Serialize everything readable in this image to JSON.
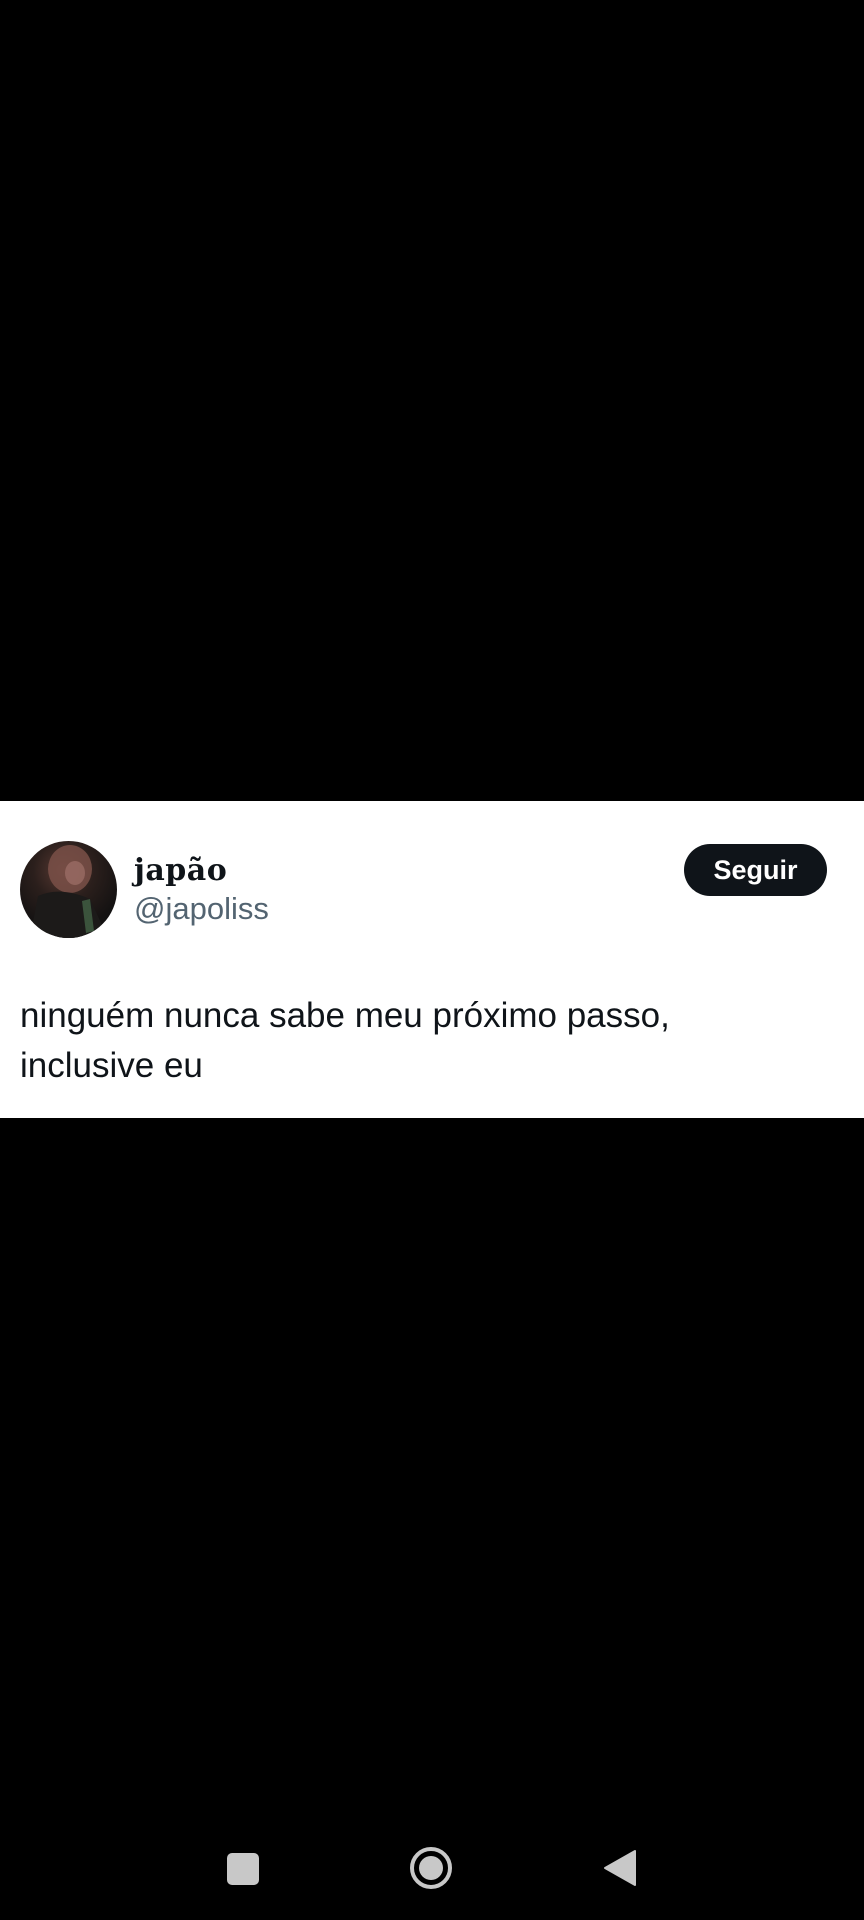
{
  "tweet": {
    "display_name": "japão",
    "handle": "@japoliss",
    "follow_label": "Seguir",
    "text_line_1": "ninguém nunca sabe meu próximo passo,",
    "text_line_2": "inclusive eu"
  },
  "colors": {
    "background": "#000000",
    "card": "#ffffff",
    "text": "#0f1419",
    "handle": "#536471",
    "button": "#0f1419"
  },
  "nav_bar": {
    "icons": [
      "recents-icon",
      "home-icon",
      "back-icon"
    ]
  }
}
